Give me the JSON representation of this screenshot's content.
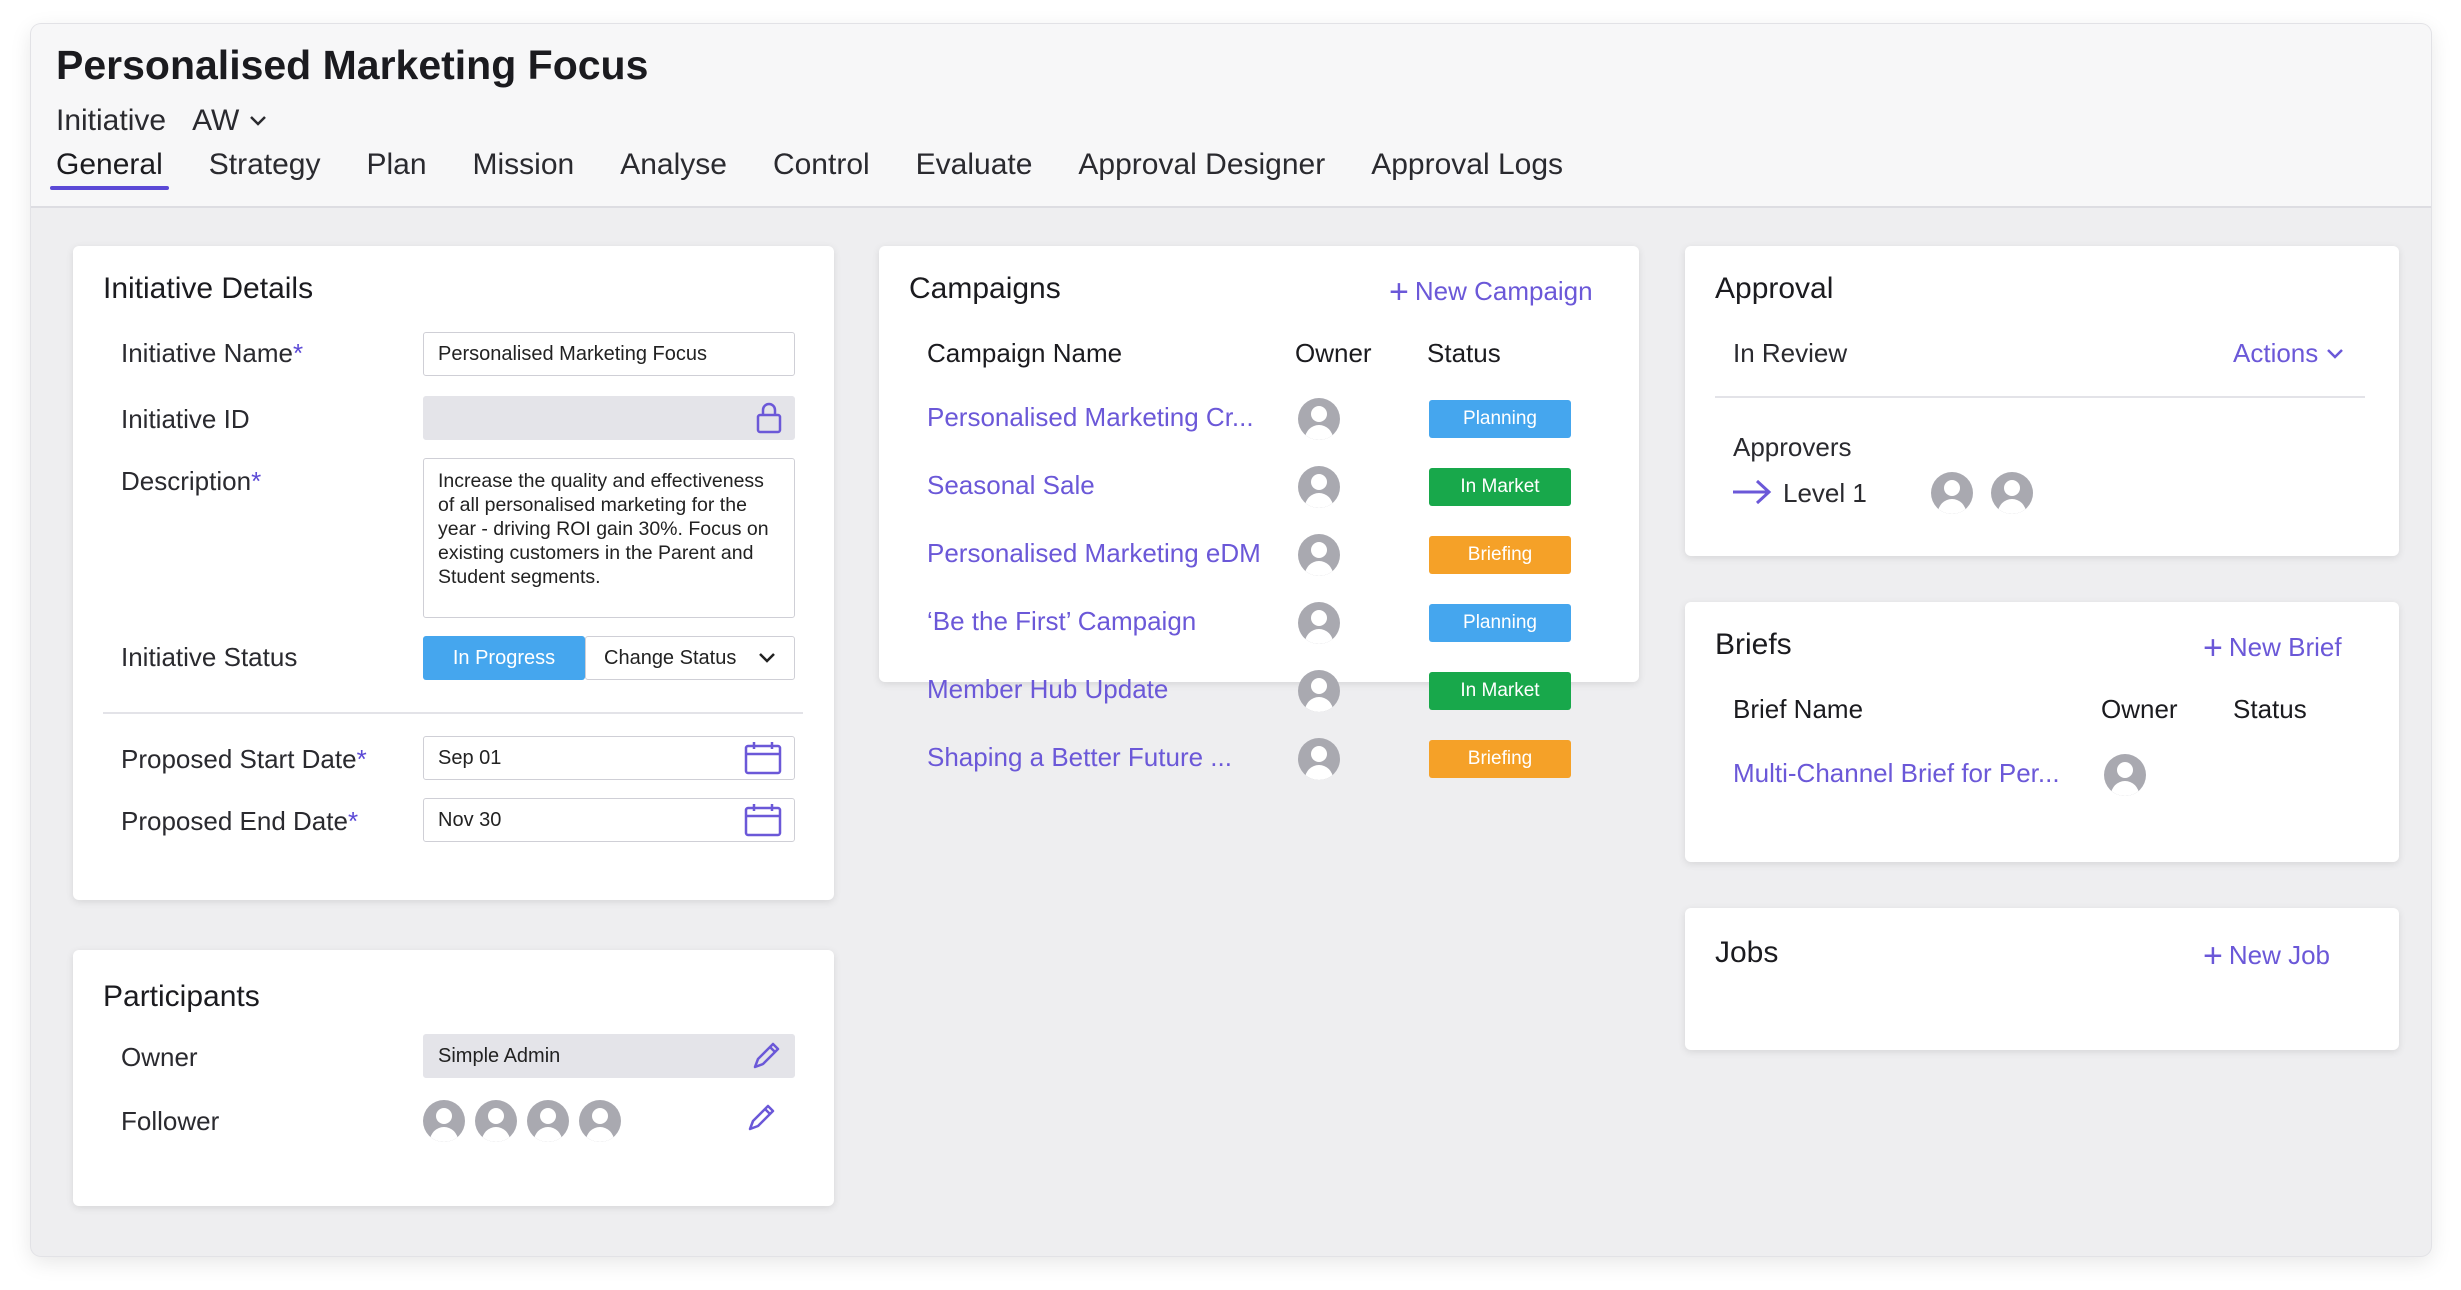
{
  "colors": {
    "accent": "#6b58d8",
    "planning": "#45a6ee",
    "in_market": "#18a84b",
    "briefing": "#f5a128"
  },
  "header": {
    "title": "Personalised Marketing Focus",
    "type_label": "Initiative",
    "owner_short": "AW",
    "tabs": [
      "General",
      "Strategy",
      "Plan",
      "Mission",
      "Analyse",
      "Control",
      "Evaluate",
      "Approval Designer",
      "Approval Logs"
    ],
    "active_tab": "General"
  },
  "initiative_details": {
    "title": "Initiative Details",
    "name_label": "Initiative Name",
    "name_value": "Personalised Marketing Focus",
    "id_label": "Initiative ID",
    "id_value": "",
    "description_label": "Description",
    "description_value": "Increase the quality and effectiveness of all personalised marketing for the year - driving ROI gain 30%. Focus on existing customers in the Parent and Student segments.",
    "status_label": "Initiative Status",
    "status_value": "In Progress",
    "change_status_label": "Change Status",
    "start_label": "Proposed Start Date",
    "start_value": "Sep 01",
    "end_label": "Proposed End Date",
    "end_value": "Nov 30",
    "required_marker": "*"
  },
  "participants": {
    "title": "Participants",
    "owner_label": "Owner",
    "owner_value": "Simple Admin",
    "follower_label": "Follower",
    "follower_count": 4
  },
  "campaigns": {
    "title": "Campaigns",
    "new_label": "New Campaign",
    "columns": [
      "Campaign Name",
      "Owner",
      "Status"
    ],
    "rows": [
      {
        "name": "Personalised Marketing Cr...",
        "status": "Planning"
      },
      {
        "name": "Seasonal Sale",
        "status": "In Market"
      },
      {
        "name": "Personalised Marketing eDM",
        "status": "Briefing"
      },
      {
        "name": "‘Be the First’ Campaign",
        "status": "Planning"
      },
      {
        "name": "Member Hub Update",
        "status": "In Market"
      },
      {
        "name": "Shaping a Better Future ...",
        "status": "Briefing"
      }
    ]
  },
  "approval": {
    "title": "Approval",
    "state": "In Review",
    "actions_label": "Actions",
    "approvers_label": "Approvers",
    "level_label": "Level 1",
    "approver_count": 2
  },
  "briefs": {
    "title": "Briefs",
    "new_label": "New Brief",
    "columns": [
      "Brief Name",
      "Owner",
      "Status"
    ],
    "rows": [
      {
        "name": "Multi-Channel Brief for Per..."
      }
    ]
  },
  "jobs": {
    "title": "Jobs",
    "new_label": "New Job"
  },
  "icons": [
    "chevron-down-icon",
    "lock-icon",
    "calendar-icon",
    "pencil-icon",
    "plus-icon",
    "arrow-right-icon",
    "avatar-icon"
  ]
}
